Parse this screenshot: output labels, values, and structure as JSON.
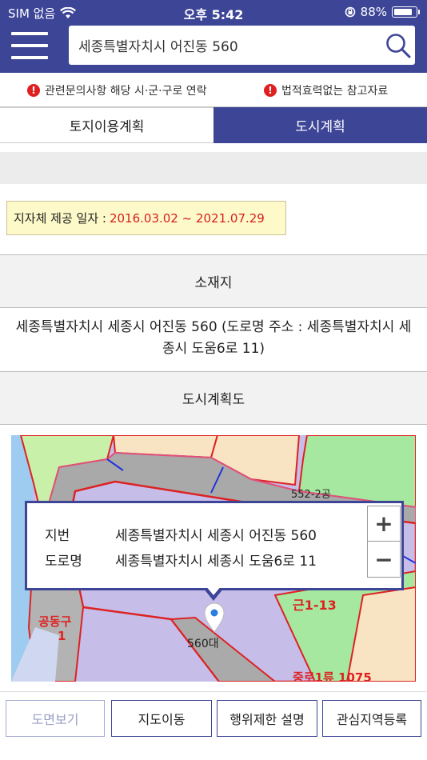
{
  "status": {
    "carrier": "SIM 없음",
    "time": "오후 5:42",
    "battery": "88%"
  },
  "search": {
    "value": "세종특별자치시 어진동 560"
  },
  "notices": [
    "관련문의사항 해당 시·군·구로 연락",
    "법적효력없는 참고자료"
  ],
  "tabs": [
    {
      "label": "토지이용계획"
    },
    {
      "label": "도시계획"
    }
  ],
  "provision": {
    "label": "지자체 제공 일자 :",
    "value": "2016.03.02 ~ 2021.07.29"
  },
  "location": {
    "heading": "소재지",
    "address": "세종특별자치시 세종시 어진동 560 (도로명 주소 : 세종특별자치시 세종시 도움6로 11)"
  },
  "map_section": {
    "heading": "도시계획도"
  },
  "popup": {
    "jibun_key": "지번",
    "jibun_value": "세종특별자치시 세종시 어진동 560",
    "road_key": "도로명",
    "road_value": "세종특별자치시 세종시 도움6로 11",
    "zoom_in": "+",
    "zoom_out": "−"
  },
  "map_labels": {
    "parcel": "560대",
    "l1": "552-2공",
    "l2": "공동구",
    "l3": "1",
    "l4": "근1-13",
    "l5": "중로1류 1075"
  },
  "buttons": [
    "도면보기",
    "지도이동",
    "행위제한 설명",
    "관심지역등록"
  ]
}
